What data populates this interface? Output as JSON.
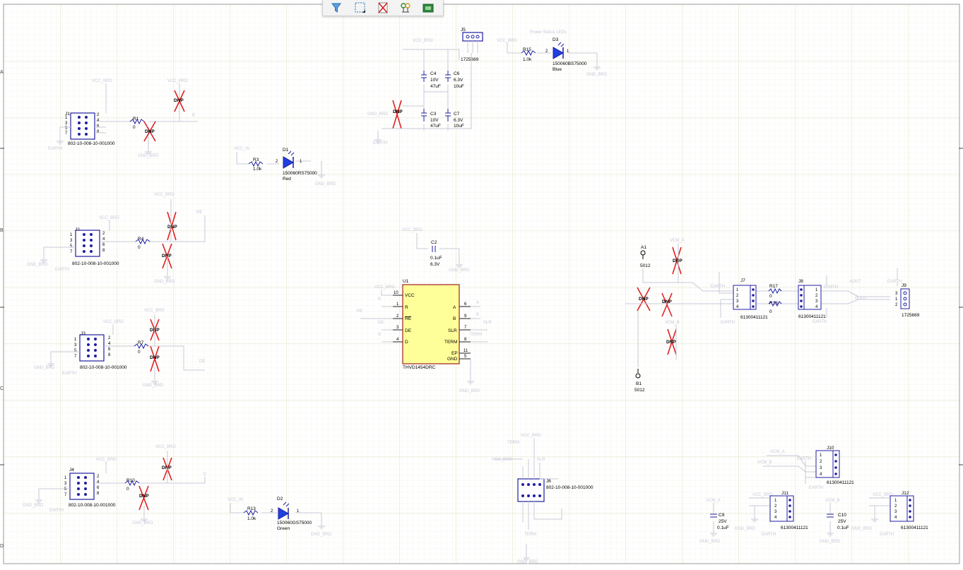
{
  "border_marks": {
    "rows": [
      "A",
      "B",
      "C",
      "D"
    ]
  },
  "toolbar": {
    "items": [
      {
        "icon": "filter-icon",
        "label": "Filter"
      },
      {
        "icon": "select-rect-icon",
        "label": "Select"
      },
      {
        "icon": "no-erc-icon",
        "label": "No ERC"
      },
      {
        "icon": "net-color-icon",
        "label": "Net Color"
      },
      {
        "icon": "board-icon",
        "label": "Board"
      }
    ]
  },
  "schematic": {
    "nets": {
      "vcc_brd": "VCC_BRD",
      "gnd_brd": "GND_BRD",
      "earth": "EARTH",
      "r": "R",
      "re": "RE",
      "de": "DE",
      "d": "D",
      "term": "TERM",
      "slr": "SLR",
      "vcm_a": "VCM_A",
      "vcm_b": "VCM_B",
      "aout": "AOUT",
      "bout": "BOUT",
      "a": "A",
      "b": "B",
      "dnp": "DNP",
      "vcc_in": "VCC_IN",
      "power_status": "Power Status LEDs"
    },
    "connectors": {
      "j1": {
        "ref": "J1",
        "part": "802-10-008-10-001000"
      },
      "j2": {
        "ref": "J2",
        "part": "802-10-008-10-001000"
      },
      "j3": {
        "ref": "J3",
        "part": "802-10-008-10-001000"
      },
      "j4": {
        "ref": "J4",
        "part": "802-10-008-10-001000"
      },
      "j5": {
        "ref": "J5",
        "part": "1725669"
      },
      "j6": {
        "ref": "J6",
        "part": "802-10-008-10-001000"
      },
      "j7": {
        "ref": "J7",
        "part": "61300411121"
      },
      "j8": {
        "ref": "J8",
        "part": "61300411121"
      },
      "j9": {
        "ref": "J9",
        "part": "1725669"
      },
      "j10": {
        "ref": "J10",
        "part": "61300411121"
      },
      "j11": {
        "ref": "J11",
        "part": "61300411121"
      },
      "j12": {
        "ref": "J12",
        "part": "61300411121"
      }
    },
    "pins8": [
      "1",
      "2",
      "3",
      "4",
      "5",
      "6",
      "7",
      "8"
    ],
    "pins4": [
      "1",
      "2",
      "3",
      "4"
    ],
    "resistors": {
      "r1": {
        "ref": "R1",
        "value": "0"
      },
      "r3": {
        "ref": "R3",
        "value": "1.0k"
      },
      "r4": {
        "ref": "R4",
        "value": "0"
      },
      "r7": {
        "ref": "R7",
        "value": "0"
      },
      "r10": {
        "ref": "R10",
        "value": "0"
      },
      "r13": {
        "ref": "R13",
        "value": "1.0k"
      },
      "r15": {
        "ref": "R15",
        "value": "1.0k"
      },
      "r17": {
        "ref": "R17",
        "value": "0"
      },
      "r18": {
        "ref": "R18",
        "value": "0"
      }
    },
    "leds": {
      "d1": {
        "ref": "D1",
        "part": "150060RS75000",
        "color": "Red"
      },
      "d2": {
        "ref": "D2",
        "part": "150060GS75000",
        "color": "Green"
      },
      "d3": {
        "ref": "D3",
        "part": "150060BS75000",
        "color": "Blue"
      }
    },
    "caps": {
      "c2": {
        "ref": "C2",
        "value": "0.1uF",
        "voltage": "6.3V"
      },
      "c3": {
        "ref": "C3",
        "value": "47uF",
        "voltage": "10V"
      },
      "c4": {
        "ref": "C4",
        "value": "47uF",
        "voltage": "10V"
      },
      "c6": {
        "ref": "C6",
        "value": "10uF",
        "voltage": "6.3V"
      },
      "c7": {
        "ref": "C7",
        "value": "10uF",
        "voltage": "6.3V"
      },
      "c9": {
        "ref": "C9",
        "value": "0.1uF",
        "voltage": "25V"
      },
      "c10": {
        "ref": "C10",
        "value": "0.1uF",
        "voltage": "25V"
      }
    },
    "testpoints": {
      "a1": {
        "ref": "A1",
        "part": "5012"
      },
      "b1": {
        "ref": "B1",
        "part": "5012"
      }
    },
    "u1": {
      "ref": "U1",
      "part": "THVD1454DRC",
      "left_pins": [
        {
          "num": "10",
          "name": "VCC"
        },
        {
          "num": "1",
          "name": "R"
        },
        {
          "num": "2",
          "name": "RE"
        },
        {
          "num": "3",
          "name": "DE"
        },
        {
          "num": "4",
          "name": "D"
        }
      ],
      "right_pins": [
        {
          "num": "6",
          "name": "A"
        },
        {
          "num": "9",
          "name": "B"
        },
        {
          "num": "7",
          "name": "SLR"
        },
        {
          "num": "8",
          "name": "TERM"
        },
        {
          "num": "11",
          "name": "EP"
        },
        {
          "num": "5",
          "name": "GND"
        }
      ]
    }
  }
}
